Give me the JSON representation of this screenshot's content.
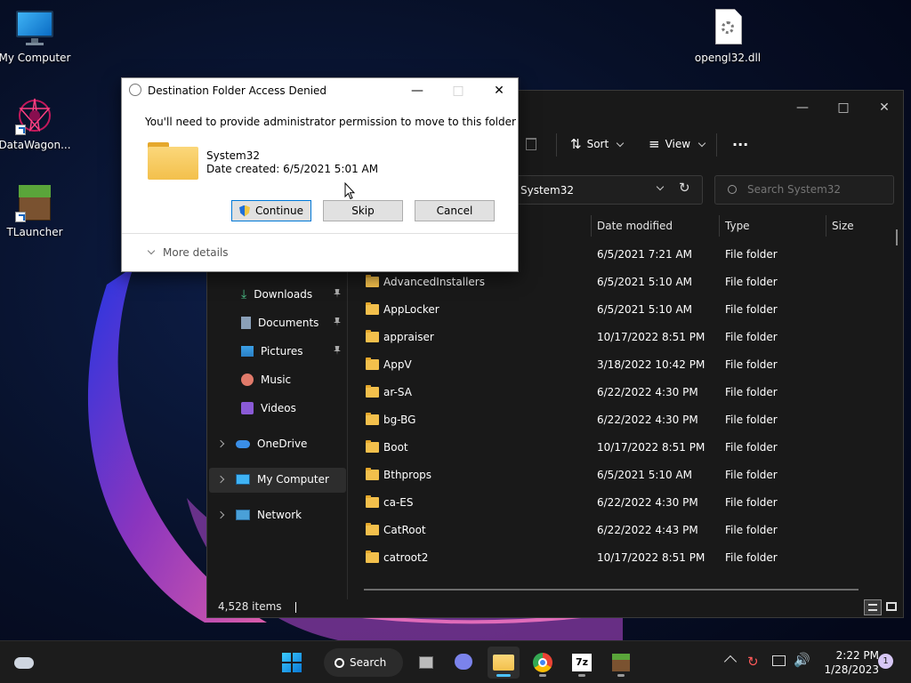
{
  "desktop": {
    "icons": [
      {
        "label": "My Computer"
      },
      {
        "label": "DataWagon..."
      },
      {
        "label": "TLauncher"
      },
      {
        "label": "opengl32.dll"
      }
    ]
  },
  "explorer": {
    "toolbar": {
      "sort_label": "Sort",
      "view_label": "View",
      "more_label": "..."
    },
    "address": "System32",
    "search_placeholder": "Search System32",
    "columns": {
      "date": "Date modified",
      "type": "Type",
      "size": "Size"
    },
    "nav": {
      "downloads": "Downloads",
      "documents": "Documents",
      "pictures": "Pictures",
      "music": "Music",
      "videos": "Videos",
      "onedrive": "OneDrive",
      "mycomputer": "My Computer",
      "network": "Network"
    },
    "rows": [
      {
        "name": "",
        "date": "6/5/2021 7:21 AM",
        "type": "File folder"
      },
      {
        "name": "AdvancedInstallers",
        "date": "6/5/2021 5:10 AM",
        "type": "File folder"
      },
      {
        "name": "AppLocker",
        "date": "6/5/2021 5:10 AM",
        "type": "File folder"
      },
      {
        "name": "appraiser",
        "date": "10/17/2022 8:51 PM",
        "type": "File folder"
      },
      {
        "name": "AppV",
        "date": "3/18/2022 10:42 PM",
        "type": "File folder"
      },
      {
        "name": "ar-SA",
        "date": "6/22/2022 4:30 PM",
        "type": "File folder"
      },
      {
        "name": "bg-BG",
        "date": "6/22/2022 4:30 PM",
        "type": "File folder"
      },
      {
        "name": "Boot",
        "date": "10/17/2022 8:51 PM",
        "type": "File folder"
      },
      {
        "name": "Bthprops",
        "date": "6/5/2021 5:10 AM",
        "type": "File folder"
      },
      {
        "name": "ca-ES",
        "date": "6/22/2022 4:30 PM",
        "type": "File folder"
      },
      {
        "name": "CatRoot",
        "date": "6/22/2022 4:43 PM",
        "type": "File folder"
      },
      {
        "name": "catroot2",
        "date": "10/17/2022 8:51 PM",
        "type": "File folder"
      }
    ],
    "status": "4,528 items"
  },
  "dialog": {
    "title": "Destination Folder Access Denied",
    "message": "You'll need to provide administrator permission to move to this folder",
    "folder_name": "System32",
    "folder_date": "Date created: 6/5/2021 5:01 AM",
    "continue_label": "Continue",
    "skip_label": "Skip",
    "cancel_label": "Cancel",
    "more_details_label": "More details"
  },
  "taskbar": {
    "search_label": "Search",
    "time": "2:22 PM",
    "date": "1/28/2023",
    "notification_count": "1"
  },
  "colors": {
    "accent": "#4cc2ff",
    "folder": "#f3c04c",
    "explorer_bg": "#191919",
    "taskbar_bg": "#1c1c1c"
  }
}
